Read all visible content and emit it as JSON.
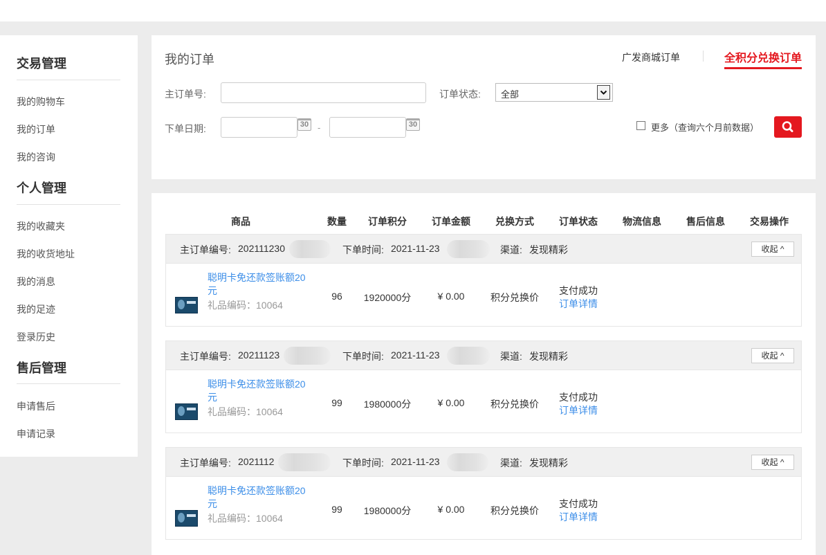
{
  "sidebar": {
    "sections": [
      {
        "title": "交易管理",
        "items": [
          "我的购物车",
          "我的订单",
          "我的咨询"
        ]
      },
      {
        "title": "个人管理",
        "items": [
          "我的收藏夹",
          "我的收货地址",
          "我的消息",
          "我的足迹",
          "登录历史"
        ]
      },
      {
        "title": "售后管理",
        "items": [
          "申请售后",
          "申请记录"
        ]
      }
    ]
  },
  "filter": {
    "title": "我的订单",
    "tabs": {
      "guangfa": "广发商城订单",
      "points": "全积分兑换订单"
    },
    "order_no_label": "主订单号:",
    "order_no_value": "",
    "status_label": "订单状态:",
    "status_value": "全部",
    "date_label": "下单日期:",
    "date_from": "",
    "date_to": "",
    "calendar_day": "30",
    "dash": "-",
    "more_label": "更多（查询六个月前数据）"
  },
  "table": {
    "headers": [
      "商品",
      "数量",
      "订单积分",
      "订单金额",
      "兑换方式",
      "订单状态",
      "物流信息",
      "售后信息",
      "交易操作"
    ]
  },
  "orders": [
    {
      "order_no_label": "主订单编号:",
      "order_no": "202111230",
      "time_label": "下单时间:",
      "time": "2021-11-23",
      "channel_label": "渠道:",
      "channel": "发现精彩",
      "collapse_label": "收起 ^",
      "product_name": "聪明卡免还款签账额20元",
      "gift_code": "礼品编码：10064",
      "quantity": "96",
      "points": "1920000分",
      "amount": "¥ 0.00",
      "exchange_method": "积分兑换价",
      "status": "支付成功",
      "detail_link": "订单详情"
    },
    {
      "order_no_label": "主订单编号:",
      "order_no": "20211123",
      "time_label": "下单时间:",
      "time": "2021-11-23",
      "channel_label": "渠道:",
      "channel": "发现精彩",
      "collapse_label": "收起 ^",
      "product_name": "聪明卡免还款签账额20元",
      "gift_code": "礼品编码：10064",
      "quantity": "99",
      "points": "1980000分",
      "amount": "¥ 0.00",
      "exchange_method": "积分兑换价",
      "status": "支付成功",
      "detail_link": "订单详情"
    },
    {
      "order_no_label": "主订单编号:",
      "order_no": "2021112",
      "time_label": "下单时间:",
      "time": "2021-11-23",
      "channel_label": "渠道:",
      "channel": "发现精彩",
      "collapse_label": "收起 ^",
      "product_name": "聪明卡免还款签账额20元",
      "gift_code": "礼品编码：10064",
      "quantity": "99",
      "points": "1980000分",
      "amount": "¥ 0.00",
      "exchange_method": "积分兑换价",
      "status": "支付成功",
      "detail_link": "订单详情"
    }
  ],
  "colors": {
    "accent": "#e4181f",
    "link": "#3c8ee8"
  },
  "icons": {
    "search": "search-icon",
    "calendar": "calendar-icon",
    "dropdown": "chevron-down-icon",
    "checkbox": "checkbox-icon"
  }
}
